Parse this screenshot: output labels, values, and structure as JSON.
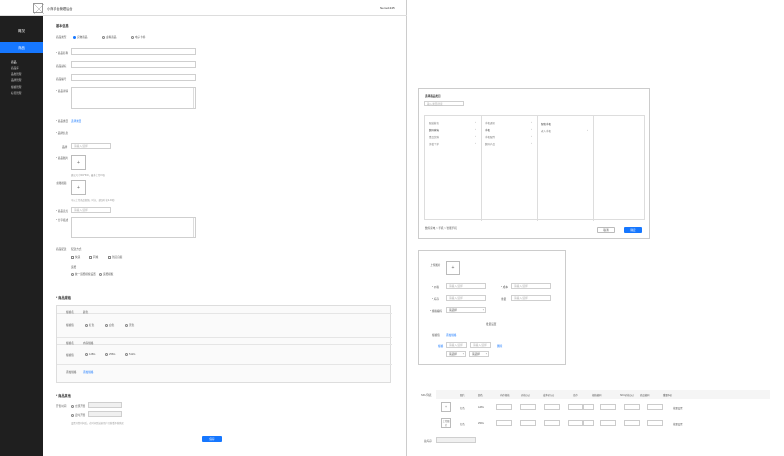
{
  "header": {
    "logo_alt": "image-placeholder",
    "title": "小商手台管理后台",
    "user": "Nemo1345"
  },
  "sidebar": {
    "top_item": "概况",
    "active_item": "商品",
    "group_title": "商品",
    "items": [
      "商品库",
      "品类管理",
      "品牌管理",
      "规格管理",
      "标签管理"
    ]
  },
  "form": {
    "section_basic": "基本信息",
    "type_label": "商品类型",
    "type_options": [
      "实物商品",
      "虚拟商品",
      "电子卡券"
    ],
    "name_label": "* 商品名称",
    "sub_label": "商品副标",
    "code_label": "商品编号",
    "intro_label": "* 商品详情",
    "category_label": "* 商品类目",
    "category_link": "选择类目",
    "brand_section": "* 品牌信息",
    "brand_label": "品牌",
    "brand_placeholder": "请输入/选择",
    "main_img_label": "* 商品图片",
    "main_img_hint": "建议尺寸800*800，最多上传15张",
    "video_label": "主图视频",
    "video_hint": "可以上传商品视频，时长、建议时长9-30秒",
    "sell_point_label": "* 商品卖点",
    "sell_point_placeholder": "请输入/选择",
    "share_label": "* 分享描述",
    "delivery_label": "商品配送",
    "delivery_sub": "配送方式",
    "delivery_options": [
      "快递",
      "同城",
      "到店自提"
    ],
    "freight_title": "运费",
    "freight_options": [
      "统一运费模板设置",
      "运费模板"
    ],
    "section_spec": "* 商品规格",
    "spec_name_1": "规格名",
    "spec_val_1": "颜色",
    "spec_value_label_1": "规格值",
    "spec_opts_1": [
      "红色",
      "白色",
      "黑色"
    ],
    "spec_name_2": "规格名",
    "spec_val_2": "内存规格",
    "spec_value_label_2": "规格值",
    "spec_opts_2": [
      "128G",
      "256G",
      "512G"
    ],
    "add_spec_label": "添加规格",
    "add_spec_link": "添加规格",
    "section_other": "* 商品其他",
    "sale_time_label": "开售时间",
    "sale_opts": [
      "立即开售",
      "定时开售"
    ],
    "sale_hint": "设置开售时间后，在时间到达前用户只能看不能购买",
    "save_label": "保存"
  },
  "category_modal": {
    "title": "选择商品类目",
    "search_placeholder": "输入类目搜索",
    "col1": [
      "服装鞋包",
      "数码家电",
      "食品饮料",
      "美妆个护"
    ],
    "col2": [
      "手机通讯",
      "手机",
      "手机配件",
      "数码产品"
    ],
    "col3": [
      "智能手机",
      "老人手机"
    ],
    "path": "数码家电 > 手机 > 智能手机",
    "cancel": "取消",
    "confirm": "确定"
  },
  "sku_modal": {
    "upload_label": "上传图片",
    "price_label": "* 价格",
    "price_placeholder": "请输入/选择",
    "cost_label": "* 成本",
    "cost_placeholder": "请输入/选择",
    "stock_label": "* 库存",
    "stock_placeholder": "请输入/选择",
    "weight_label": "重量",
    "weight_placeholder": "请输入/选择",
    "code_label": "* 规格编码",
    "code_value": "请选择",
    "divider": "批量设置",
    "spec_label": "规格值",
    "spec_link": "添加规格",
    "row_label": "规格",
    "row_ph1": "请输入/选择",
    "row_ph2": "请输入/选择",
    "row_delete": "删除",
    "sel1": "请选择",
    "sel2": "请选择"
  },
  "sku_table": {
    "label": "SKU列表",
    "headers": [
      "图片",
      "颜色",
      "内存规格",
      "价格(元)",
      "成本价(元)",
      "库存",
      "规格编码",
      "SKU价格(元)",
      "商品编码",
      "重量(kg)"
    ],
    "rows": [
      {
        "color": "红色",
        "mem": "128G",
        "action": "批量设置"
      },
      {
        "color": "红色",
        "mem": "256G",
        "action": "批量设置"
      }
    ],
    "row2_upload": "上传图片",
    "total_label": "总库存"
  }
}
